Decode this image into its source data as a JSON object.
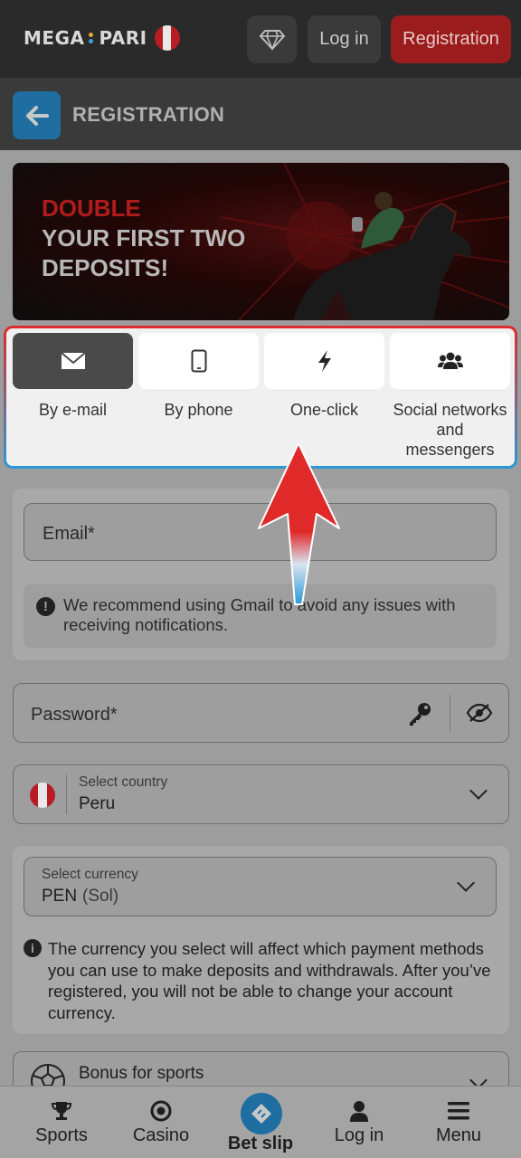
{
  "header": {
    "logo_text_left": "MEGA",
    "logo_text_right": "PARI",
    "login_label": "Log in",
    "register_label": "Registration"
  },
  "subheader": {
    "title": "REGISTRATION"
  },
  "banner": {
    "line1": "DOUBLE",
    "line2": "YOUR FIRST TWO",
    "line3": "DEPOSITS!"
  },
  "registration_tabs": [
    {
      "label": "By e-mail",
      "icon": "envelope-icon",
      "active": true
    },
    {
      "label": "By phone",
      "icon": "phone-icon",
      "active": false
    },
    {
      "label": "One-click",
      "icon": "lightning-icon",
      "active": false
    },
    {
      "label": "Social networks and messengers",
      "icon": "users-icon",
      "active": false
    }
  ],
  "form": {
    "email_placeholder": "Email*",
    "email_notice": "We recommend using Gmail to avoid any issues with receiving notifications.",
    "password_placeholder": "Password*",
    "country_label": "Select country",
    "country_value": "Peru",
    "currency_label": "Select currency",
    "currency_code": "PEN",
    "currency_name": "(Sol)",
    "currency_notice": "The currency you select will affect which payment methods you can use to make deposits and withdrawals. After you’ve registered, you will not be able to change your account currency.",
    "bonus_label": "Bonus for sports"
  },
  "bottom_nav": {
    "sports": "Sports",
    "casino": "Casino",
    "betslip": "Bet slip",
    "login": "Log in",
    "menu": "Menu"
  },
  "colors": {
    "register_button": "#9a1c1c",
    "back_button": "#1f6ea2",
    "active_tab": "#4a4a4a",
    "arrow_red": "#e02a2a",
    "arrow_blue": "#2a9ad6"
  }
}
